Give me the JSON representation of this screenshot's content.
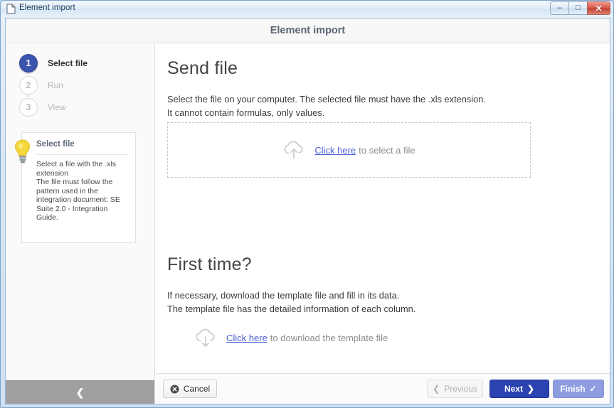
{
  "window": {
    "title": "Element import",
    "icon": "document-icon",
    "controls": {
      "minimize": "–",
      "maximize": "□",
      "close": "✕"
    }
  },
  "dialog": {
    "title": "Element import"
  },
  "sidebar": {
    "steps": [
      {
        "number": "1",
        "label": "Select file",
        "state": "active"
      },
      {
        "number": "2",
        "label": "Run",
        "state": "inactive"
      },
      {
        "number": "3",
        "label": "View",
        "state": "inactive"
      }
    ],
    "tip": {
      "icon": "lightbulb-icon",
      "title": "Select file",
      "body": "Select a file with the .xls extension\nThe file must follow the pattern used in the integration document: SE Suite 2.0 - Integration Guide."
    },
    "collapse": {
      "icon": "chevron-left-icon",
      "glyph": "❮"
    }
  },
  "main": {
    "send_file": {
      "heading": "Send file",
      "description": "Select the file on your computer. The selected file must have the .xls extension.\nIt cannot contain formulas, only values.",
      "dropzone": {
        "icon": "cloud-upload-icon",
        "link_label": "Click here",
        "suffix_label": "to select a file"
      }
    },
    "first_time": {
      "heading": "First time?",
      "description": "If necessary, download the template file and fill in its data.\nThe template file has the detailed information of each column.",
      "download": {
        "icon": "cloud-download-icon",
        "link_label": "Click here",
        "suffix_label": "to download the template file"
      }
    }
  },
  "footer": {
    "cancel": {
      "label": "Cancel",
      "icon": "cancel-circle-icon"
    },
    "previous": {
      "label": "Previous",
      "icon": "chevron-left-icon",
      "glyph": "❮"
    },
    "next": {
      "label": "Next",
      "icon": "chevron-right-icon",
      "glyph": "❯"
    },
    "finish": {
      "label": "Finish",
      "icon": "check-icon",
      "glyph": "✓"
    }
  },
  "colors": {
    "accent_blue": "#2b43b0",
    "step_active": "#3a55ad",
    "link": "#4a5ed6",
    "finish_blue": "#8e9de0",
    "muted": "#8c8c8c",
    "bulb_yellow": "#f5d33a"
  }
}
